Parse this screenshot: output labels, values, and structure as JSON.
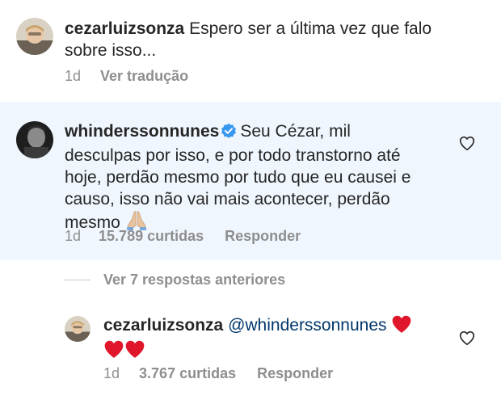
{
  "comment1": {
    "username": "cezarluizsonza",
    "text_line1": "Espero ser a última vez que falo",
    "text_line2": "sobre isso...",
    "time": "1d",
    "translate": "Ver tradução"
  },
  "comment2": {
    "username": "whinderssonnunes",
    "text_line1": "Seu Cézar, mil",
    "text_line2": "desculpas por isso, e por todo transtorno até",
    "text_line3": "hoje, perdão mesmo por tudo que eu causei e",
    "text_line4": "causo, isso não vai mais acontecer, perdão",
    "text_line5": "mesmo",
    "emoji_icon": "pray-hands-icon",
    "time": "1d",
    "likes": "15.789 curtidas",
    "reply": "Responder",
    "highlight_color": "#eff6fd",
    "verified_color": "#3897f0"
  },
  "view_replies": {
    "label": "Ver 7 respostas anteriores"
  },
  "comment3": {
    "username": "cezarluizsonza",
    "mention": "@whinderssonnunes",
    "emoji_icon": "red-heart-icon",
    "time": "1d",
    "likes": "3.767 curtidas",
    "reply": "Responder",
    "heart_color": "#e0162b"
  }
}
